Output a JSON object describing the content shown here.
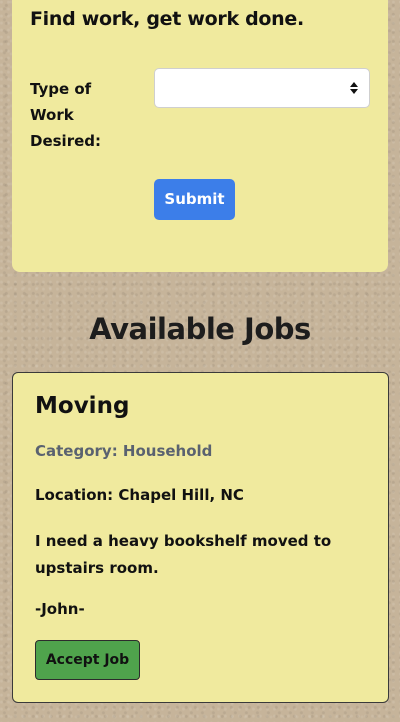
{
  "form": {
    "heading": "Find work, get work done.",
    "type_label": "Type of Work Desired:",
    "type_select_value": "",
    "submit_label": "Submit"
  },
  "jobs_section": {
    "title": "Available Jobs"
  },
  "jobs": [
    {
      "title": "Moving",
      "category": "Category: Household",
      "location": "Location: Chapel Hill, NC",
      "description": "I need a heavy bookshelf moved to upstairs room.",
      "poster": "-John-",
      "accept_label": "Accept Job"
    }
  ],
  "colors": {
    "card_background": "#f0ea9e",
    "submit_button": "#3c7ee9",
    "accept_button": "#4fa34c",
    "category_text": "#5a6270"
  },
  "icons": {
    "select_arrows": "up-down-arrows-icon"
  }
}
